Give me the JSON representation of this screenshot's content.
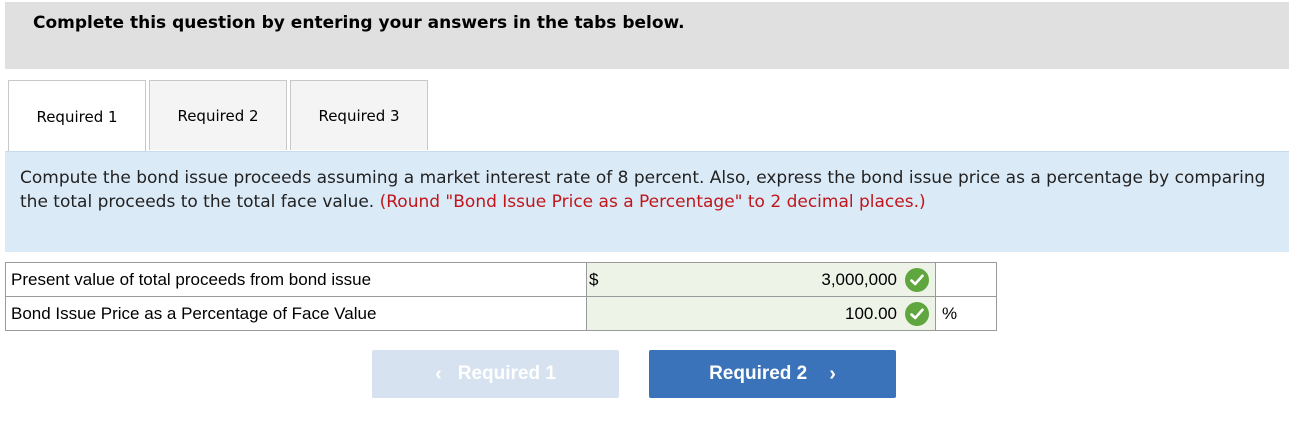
{
  "header": {
    "title": "Complete this question by entering your answers in the tabs below."
  },
  "tabs": [
    {
      "label": "Required 1",
      "active": true
    },
    {
      "label": "Required 2",
      "active": false
    },
    {
      "label": "Required 3",
      "active": false
    }
  ],
  "instruction": {
    "text": "Compute the bond issue proceeds assuming a market interest rate of 8 percent. Also, express the bond issue price as a percentage by comparing the total proceeds to the total face value.",
    "note": "(Round \"Bond Issue Price as a Percentage\" to 2 decimal places.)"
  },
  "rows": [
    {
      "label": "Present value of total proceeds from bond issue",
      "currency": "$",
      "value": "3,000,000",
      "unit": "",
      "status": "correct"
    },
    {
      "label": "Bond Issue Price as a Percentage of Face Value",
      "currency": "",
      "value": "100.00",
      "unit": "%",
      "status": "correct"
    }
  ],
  "nav": {
    "prev_label": "Required 1",
    "next_label": "Required 2"
  },
  "colors": {
    "correct": "#5fa63f",
    "next_button": "#3a73b9",
    "prev_button_disabled": "#d6e2ef",
    "note_red": "#c0161b"
  }
}
